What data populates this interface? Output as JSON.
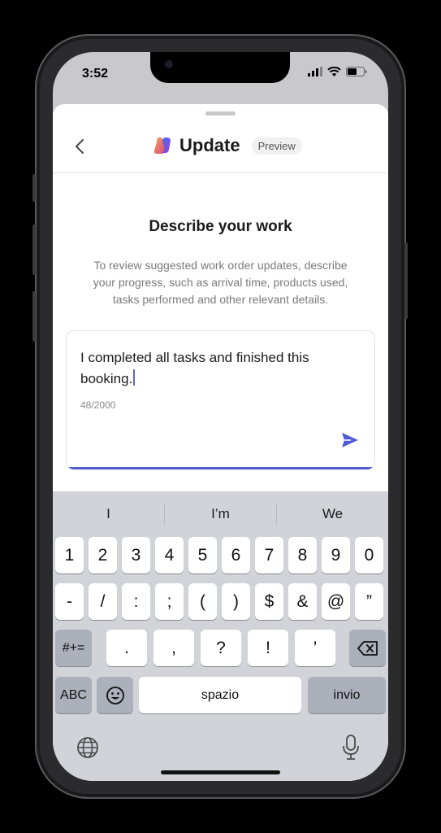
{
  "status": {
    "time": "3:52"
  },
  "header": {
    "title": "Update",
    "badge": "Preview"
  },
  "main": {
    "heading": "Describe your work",
    "description": "To review suggested work order updates, describe your progress, such as arrival time, products used, tasks performed and other relevant details.",
    "input": {
      "value": "I completed all tasks and finished this booking.",
      "counter": "48/2000"
    }
  },
  "colors": {
    "accent": "#4f5bd5",
    "keyboard_bg": "#d1d3d9"
  },
  "keyboard": {
    "suggestions": [
      "I",
      "I’m",
      "We"
    ],
    "row1": [
      "1",
      "2",
      "3",
      "4",
      "5",
      "6",
      "7",
      "8",
      "9",
      "0"
    ],
    "row2": [
      "-",
      "/",
      ":",
      ";",
      "(",
      ")",
      "$",
      "&",
      "@",
      "”"
    ],
    "row3": {
      "mode": "#+=",
      "keys": [
        ".",
        ",",
        "?",
        "!",
        "’"
      ]
    },
    "row4": {
      "abc": "ABC",
      "space": "spazio",
      "return": "invio"
    }
  }
}
